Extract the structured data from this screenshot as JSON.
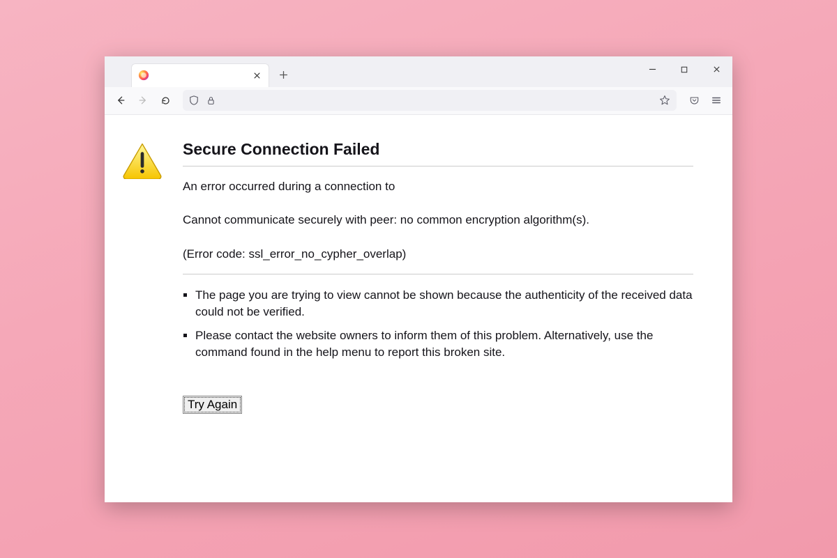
{
  "tab": {
    "title": ""
  },
  "error": {
    "title": "Secure Connection Failed",
    "line1": "An error occurred during a connection to",
    "line2": "Cannot communicate securely with peer: no common encryption algorithm(s).",
    "line3": "(Error code: ssl_error_no_cypher_overlap)",
    "bullets": [
      "The page you are trying to view cannot be shown because the authenticity of the received data could not be verified.",
      "Please contact the website owners to inform them of this problem. Alternatively, use the command found in the help menu to report this broken site."
    ],
    "retry_label": "Try Again"
  }
}
